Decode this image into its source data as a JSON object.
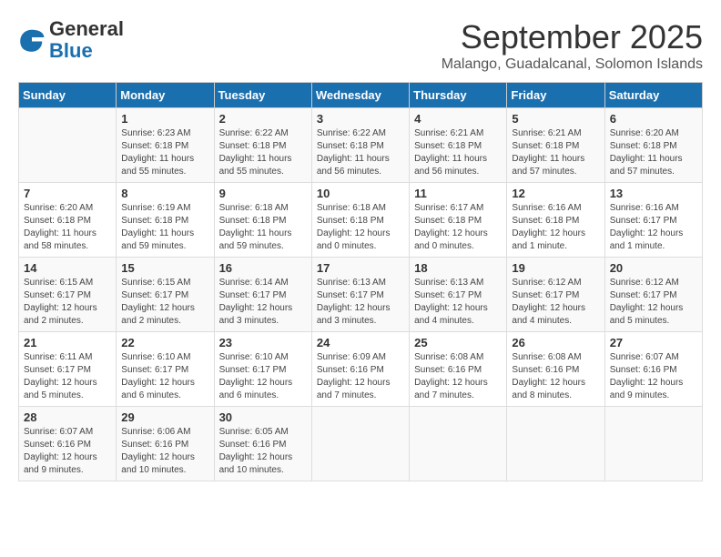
{
  "logo": {
    "general": "General",
    "blue": "Blue"
  },
  "title": "September 2025",
  "subtitle": "Malango, Guadalcanal, Solomon Islands",
  "days_of_week": [
    "Sunday",
    "Monday",
    "Tuesday",
    "Wednesday",
    "Thursday",
    "Friday",
    "Saturday"
  ],
  "weeks": [
    [
      {
        "day": "",
        "info": ""
      },
      {
        "day": "1",
        "info": "Sunrise: 6:23 AM\nSunset: 6:18 PM\nDaylight: 11 hours\nand 55 minutes."
      },
      {
        "day": "2",
        "info": "Sunrise: 6:22 AM\nSunset: 6:18 PM\nDaylight: 11 hours\nand 55 minutes."
      },
      {
        "day": "3",
        "info": "Sunrise: 6:22 AM\nSunset: 6:18 PM\nDaylight: 11 hours\nand 56 minutes."
      },
      {
        "day": "4",
        "info": "Sunrise: 6:21 AM\nSunset: 6:18 PM\nDaylight: 11 hours\nand 56 minutes."
      },
      {
        "day": "5",
        "info": "Sunrise: 6:21 AM\nSunset: 6:18 PM\nDaylight: 11 hours\nand 57 minutes."
      },
      {
        "day": "6",
        "info": "Sunrise: 6:20 AM\nSunset: 6:18 PM\nDaylight: 11 hours\nand 57 minutes."
      }
    ],
    [
      {
        "day": "7",
        "info": "Sunrise: 6:20 AM\nSunset: 6:18 PM\nDaylight: 11 hours\nand 58 minutes."
      },
      {
        "day": "8",
        "info": "Sunrise: 6:19 AM\nSunset: 6:18 PM\nDaylight: 11 hours\nand 59 minutes."
      },
      {
        "day": "9",
        "info": "Sunrise: 6:18 AM\nSunset: 6:18 PM\nDaylight: 11 hours\nand 59 minutes."
      },
      {
        "day": "10",
        "info": "Sunrise: 6:18 AM\nSunset: 6:18 PM\nDaylight: 12 hours\nand 0 minutes."
      },
      {
        "day": "11",
        "info": "Sunrise: 6:17 AM\nSunset: 6:18 PM\nDaylight: 12 hours\nand 0 minutes."
      },
      {
        "day": "12",
        "info": "Sunrise: 6:16 AM\nSunset: 6:18 PM\nDaylight: 12 hours\nand 1 minute."
      },
      {
        "day": "13",
        "info": "Sunrise: 6:16 AM\nSunset: 6:17 PM\nDaylight: 12 hours\nand 1 minute."
      }
    ],
    [
      {
        "day": "14",
        "info": "Sunrise: 6:15 AM\nSunset: 6:17 PM\nDaylight: 12 hours\nand 2 minutes."
      },
      {
        "day": "15",
        "info": "Sunrise: 6:15 AM\nSunset: 6:17 PM\nDaylight: 12 hours\nand 2 minutes."
      },
      {
        "day": "16",
        "info": "Sunrise: 6:14 AM\nSunset: 6:17 PM\nDaylight: 12 hours\nand 3 minutes."
      },
      {
        "day": "17",
        "info": "Sunrise: 6:13 AM\nSunset: 6:17 PM\nDaylight: 12 hours\nand 3 minutes."
      },
      {
        "day": "18",
        "info": "Sunrise: 6:13 AM\nSunset: 6:17 PM\nDaylight: 12 hours\nand 4 minutes."
      },
      {
        "day": "19",
        "info": "Sunrise: 6:12 AM\nSunset: 6:17 PM\nDaylight: 12 hours\nand 4 minutes."
      },
      {
        "day": "20",
        "info": "Sunrise: 6:12 AM\nSunset: 6:17 PM\nDaylight: 12 hours\nand 5 minutes."
      }
    ],
    [
      {
        "day": "21",
        "info": "Sunrise: 6:11 AM\nSunset: 6:17 PM\nDaylight: 12 hours\nand 5 minutes."
      },
      {
        "day": "22",
        "info": "Sunrise: 6:10 AM\nSunset: 6:17 PM\nDaylight: 12 hours\nand 6 minutes."
      },
      {
        "day": "23",
        "info": "Sunrise: 6:10 AM\nSunset: 6:17 PM\nDaylight: 12 hours\nand 6 minutes."
      },
      {
        "day": "24",
        "info": "Sunrise: 6:09 AM\nSunset: 6:16 PM\nDaylight: 12 hours\nand 7 minutes."
      },
      {
        "day": "25",
        "info": "Sunrise: 6:08 AM\nSunset: 6:16 PM\nDaylight: 12 hours\nand 7 minutes."
      },
      {
        "day": "26",
        "info": "Sunrise: 6:08 AM\nSunset: 6:16 PM\nDaylight: 12 hours\nand 8 minutes."
      },
      {
        "day": "27",
        "info": "Sunrise: 6:07 AM\nSunset: 6:16 PM\nDaylight: 12 hours\nand 9 minutes."
      }
    ],
    [
      {
        "day": "28",
        "info": "Sunrise: 6:07 AM\nSunset: 6:16 PM\nDaylight: 12 hours\nand 9 minutes."
      },
      {
        "day": "29",
        "info": "Sunrise: 6:06 AM\nSunset: 6:16 PM\nDaylight: 12 hours\nand 10 minutes."
      },
      {
        "day": "30",
        "info": "Sunrise: 6:05 AM\nSunset: 6:16 PM\nDaylight: 12 hours\nand 10 minutes."
      },
      {
        "day": "",
        "info": ""
      },
      {
        "day": "",
        "info": ""
      },
      {
        "day": "",
        "info": ""
      },
      {
        "day": "",
        "info": ""
      }
    ]
  ]
}
